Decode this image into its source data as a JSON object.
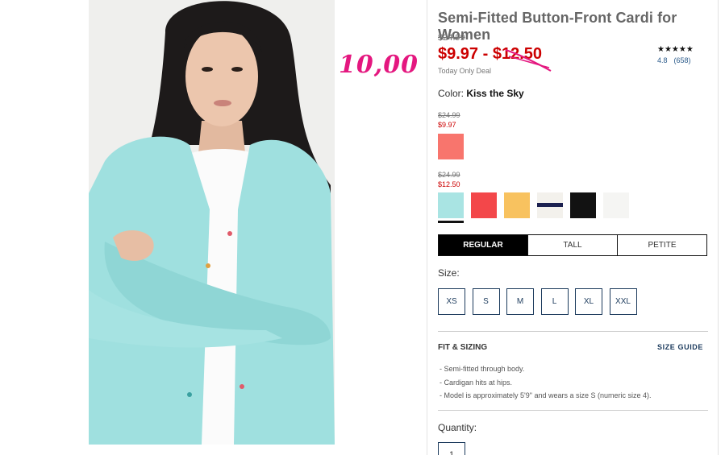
{
  "annotation": {
    "text": "10,00",
    "color": "#e4177f"
  },
  "product": {
    "title": "Semi-Fitted Button-Front Cardi for Women",
    "original_price": "$24.99",
    "sale_price": "$9.97 - $12.50",
    "deal_label": "Today Only Deal",
    "rating_stars": "★★★★★",
    "rating_value": "4.8",
    "review_count": "(658)"
  },
  "color": {
    "label": "Color:",
    "selected": "Kiss the Sky",
    "groups": [
      {
        "original": "$24.99",
        "sale": "$9.97",
        "swatches": [
          {
            "name": "coral",
            "hex": "#f8756d"
          }
        ]
      },
      {
        "original": "$24.99",
        "sale": "$12.50",
        "swatches": [
          {
            "name": "kiss-the-sky",
            "hex": "#a9e4e3"
          },
          {
            "name": "red",
            "hex": "#f3474a"
          },
          {
            "name": "mustard",
            "hex": "#f8c25f"
          },
          {
            "name": "stripe",
            "hex": "#f3f1ec"
          },
          {
            "name": "black",
            "hex": "#121212"
          },
          {
            "name": "white",
            "hex": "#f5f5f3"
          }
        ]
      }
    ]
  },
  "fit_options": [
    "REGULAR",
    "TALL",
    "PETITE"
  ],
  "size": {
    "label": "Size:",
    "options": [
      "XS",
      "S",
      "M",
      "L",
      "XL",
      "XXL"
    ]
  },
  "fit_sizing": {
    "heading": "FIT & SIZING",
    "guide_link": "SIZE GUIDE",
    "bullets": [
      "Semi-fitted through body.",
      "Cardigan hits at hips.",
      "Model is approximately 5'9\" and wears a size S (numeric size 4)."
    ]
  },
  "quantity": {
    "label": "Quantity:",
    "value": "1"
  }
}
